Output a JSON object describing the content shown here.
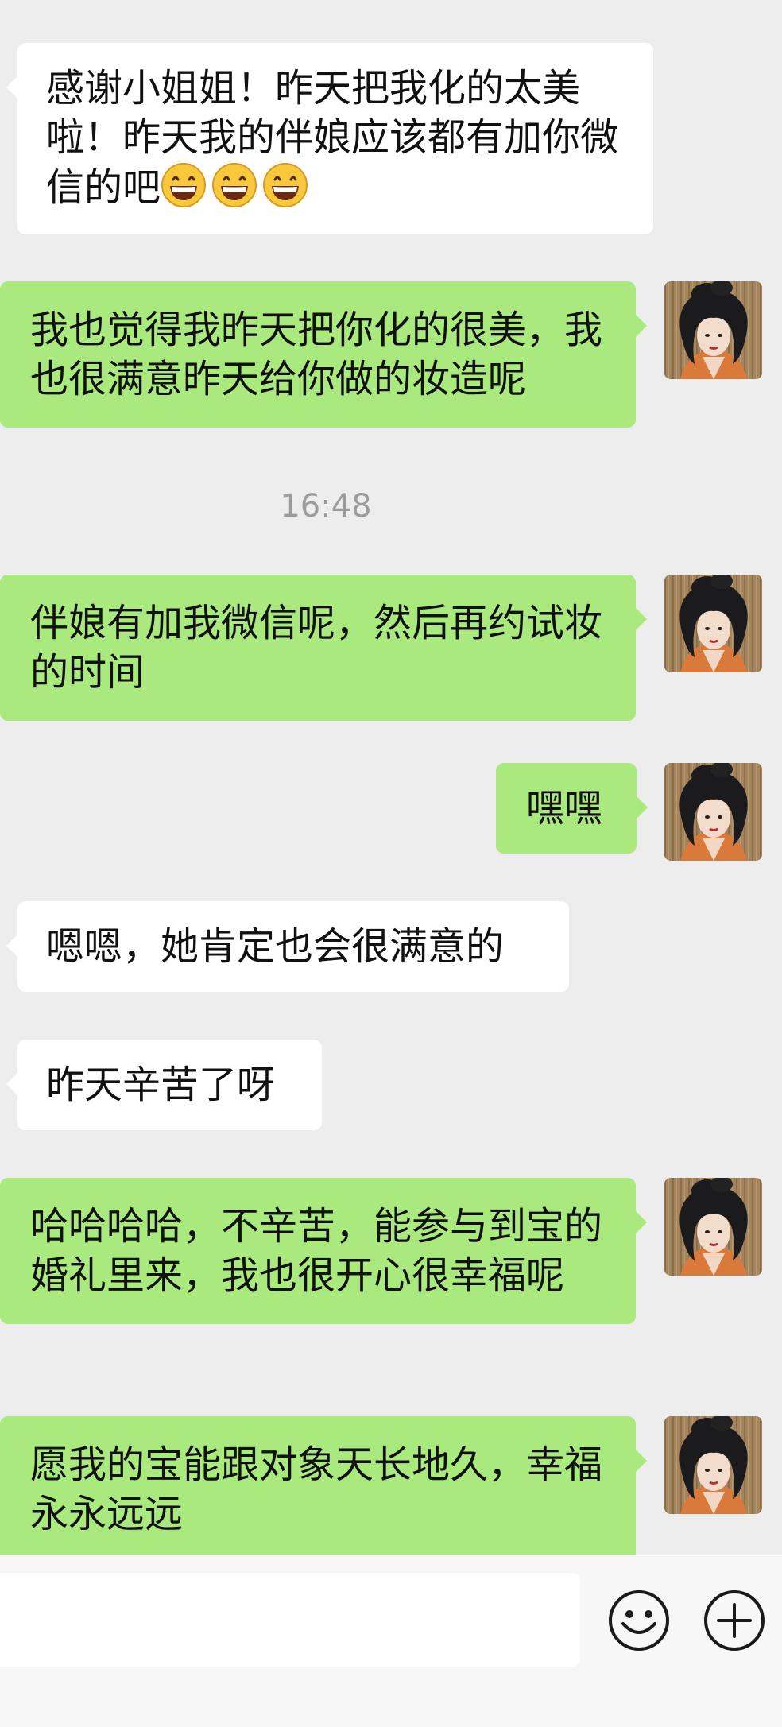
{
  "messages": [
    {
      "side": "left",
      "text": "感谢小姐姐！昨天把我化的太美啦！昨天我的伴娘应该都有加你微信的吧",
      "emoji_count": 3
    },
    {
      "side": "right",
      "text": "我也觉得我昨天把你化的很美，我也很满意昨天给你做的妆造呢"
    },
    {
      "type": "time",
      "text": "16:48"
    },
    {
      "side": "right",
      "text": "伴娘有加我微信呢，然后再约试妆的时间"
    },
    {
      "side": "right",
      "text": "嘿嘿"
    },
    {
      "side": "left",
      "text": "嗯嗯，她肯定也会很满意的"
    },
    {
      "side": "left",
      "text": "昨天辛苦了呀"
    },
    {
      "side": "right",
      "text": "哈哈哈哈，不辛苦，能参与到宝的婚礼里来，我也很开心很幸福呢"
    },
    {
      "side": "right",
      "text": "愿我的宝能跟对象天长地久，幸福永永远远"
    }
  ],
  "emoji_name": "grinning-face-emoji",
  "input": {
    "value": "",
    "emoji_button_icon": "smiley-face-icon",
    "plus_button_icon": "plus-circle-icon"
  },
  "colors": {
    "background": "#ededed",
    "incoming_bubble": "#ffffff",
    "outgoing_bubble": "#a9e97d",
    "timestamp": "#9b9b9b"
  }
}
